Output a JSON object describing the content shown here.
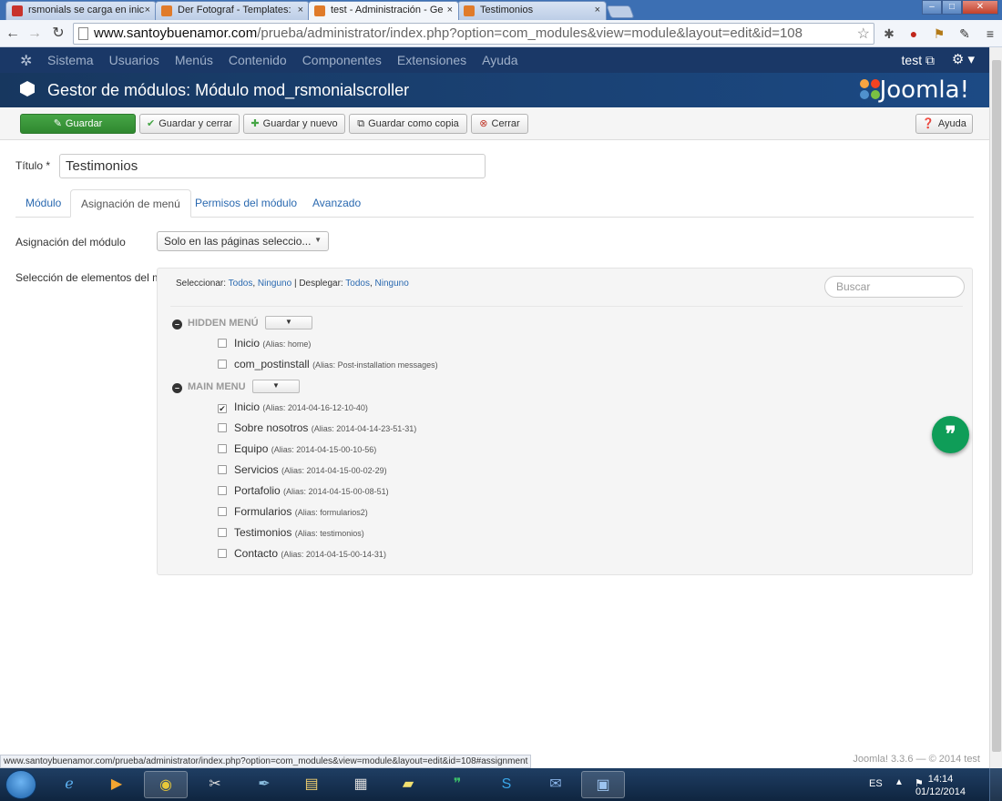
{
  "browser": {
    "tabs": [
      {
        "title": "rsmonials se carga en inic",
        "icon_color": "#c8332c"
      },
      {
        "title": "Der Fotograf - Templates:",
        "icon_color": "#e07b2a"
      },
      {
        "title": "test - Administración - Ge",
        "icon_color": "#e07b2a"
      },
      {
        "title": "Testimonios",
        "icon_color": "#e07b2a"
      }
    ],
    "close_glyph": "×",
    "url_host": "www.santoybuenamor.com",
    "url_path": "/prueba/administrator/index.php?option=com_modules&view=module&layout=edit&id=108",
    "status_url": "www.santoybuenamor.com/prueba/administrator/index.php?option=com_modules&view=module&layout=edit&id=108#assignment"
  },
  "navbar": {
    "menu": [
      "Sistema",
      "Usuarios",
      "Menús",
      "Contenido",
      "Componentes",
      "Extensiones",
      "Ayuda"
    ],
    "user": "test"
  },
  "header": {
    "title": "Gestor de módulos: Módulo mod_rsmonialscroller",
    "brand": "Joomla!"
  },
  "toolbar": {
    "save": "Guardar",
    "save_close": "Guardar y cerrar",
    "save_new": "Guardar y nuevo",
    "save_copy": "Guardar como copia",
    "close": "Cerrar",
    "help": "Ayuda"
  },
  "form": {
    "title_label": "Título *",
    "title_value": "Testimonios",
    "tabs": [
      "Módulo",
      "Asignación de menú",
      "Permisos del módulo",
      "Avanzado"
    ],
    "assignment_label": "Asignación del módulo",
    "assignment_value": "Solo en las páginas seleccio...",
    "selection_label": "Selección de elementos del menú:"
  },
  "tree": {
    "select_label": "Seleccionar:",
    "expand_label": "Desplegar:",
    "all": "Todos",
    "none": "Ninguno",
    "separator": ",",
    "pipe": "|",
    "search_placeholder": "Buscar",
    "groups": [
      {
        "name": "HIDDEN MENÚ",
        "items": [
          {
            "label": "Inicio",
            "alias": "(Alias: home)",
            "checked": false
          },
          {
            "label": "com_postinstall",
            "alias": "(Alias: Post-installation messages)",
            "checked": false
          }
        ]
      },
      {
        "name": "MAIN MENU",
        "items": [
          {
            "label": "Inicio",
            "alias": "(Alias: 2014-04-16-12-10-40)",
            "checked": true
          },
          {
            "label": "Sobre nosotros",
            "alias": "(Alias: 2014-04-14-23-51-31)",
            "checked": false
          },
          {
            "label": "Equipo",
            "alias": "(Alias: 2014-04-15-00-10-56)",
            "checked": false
          },
          {
            "label": "Servicios",
            "alias": "(Alias: 2014-04-15-00-02-29)",
            "checked": false
          },
          {
            "label": "Portafolio",
            "alias": "(Alias: 2014-04-15-00-08-51)",
            "checked": false
          },
          {
            "label": "Formularios",
            "alias": "(Alias: formularios2)",
            "checked": false
          },
          {
            "label": "Testimonios",
            "alias": "(Alias: testimonios)",
            "checked": false
          },
          {
            "label": "Contacto",
            "alias": "(Alias: 2014-04-15-00-14-31)",
            "checked": false
          }
        ]
      }
    ]
  },
  "footer": "Joomla! 3.3.6 — © 2014 test",
  "taskbar": {
    "lang": "ES",
    "time": "14:14",
    "date": "01/12/2014"
  },
  "colors": {
    "navbar": "#1a3867",
    "header": "#1c4a85",
    "save_green": "#46a546",
    "link": "#2a69b0",
    "hangouts": "#0f9d58"
  }
}
